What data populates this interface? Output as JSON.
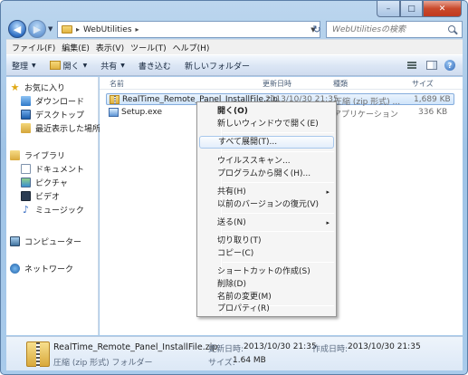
{
  "window": {
    "controls": {
      "minimize": "–",
      "maximize": "□",
      "close": "✕"
    }
  },
  "address": {
    "path": "WebUtilities",
    "separator": "▸"
  },
  "search": {
    "placeholder": "WebUtilitiesの検索"
  },
  "menubar": [
    "ファイル(F)",
    "編集(E)",
    "表示(V)",
    "ツール(T)",
    "ヘルプ(H)"
  ],
  "commandbar": {
    "organize": "整理",
    "open": "開く",
    "share": "共有",
    "burn": "書き込む",
    "new_folder": "新しいフォルダー"
  },
  "navpane": {
    "favorites": "お気に入り",
    "downloads": "ダウンロード",
    "desktop": "デスクトップ",
    "recent": "最近表示した場所",
    "libraries": "ライブラリ",
    "documents": "ドキュメント",
    "pictures": "ピクチャ",
    "videos": "ビデオ",
    "music": "ミュージック",
    "computer": "コンピューター",
    "network": "ネットワーク"
  },
  "columns": {
    "name": "名前",
    "modified": "更新日時",
    "type": "種類",
    "size": "サイズ"
  },
  "files": [
    {
      "name": "RealTime_Remote_Panel_InstallFile.zip",
      "modified": "2013/10/30 21:35",
      "type": "圧縮 (zip 形式) ...",
      "size": "1,689 KB"
    },
    {
      "name": "Setup.exe",
      "modified": "",
      "type": "アプリケーション",
      "size": "336 KB"
    }
  ],
  "context_menu": {
    "open": "開く(O)",
    "open_new_window": "新しいウィンドウで開く(E)",
    "extract_all": "すべて展開(T)...",
    "virus_scan": "ウイルススキャン...",
    "open_with": "プログラムから開く(H)...",
    "share": "共有(H)",
    "restore_previous": "以前のバージョンの復元(V)",
    "send_to": "送る(N)",
    "cut": "切り取り(T)",
    "copy": "コピー(C)",
    "create_shortcut": "ショートカットの作成(S)",
    "delete": "削除(D)",
    "rename": "名前の変更(M)",
    "properties": "プロパティ(R)",
    "submenu_arrow": "▸"
  },
  "details": {
    "filename": "RealTime_Remote_Panel_InstallFile.zip",
    "modified_label": "更新日時:",
    "modified_value": "2013/10/30 21:35",
    "created_label": "作成日時:",
    "created_value": "2013/10/30 21:35",
    "type": "圧縮 (zip 形式) フォルダー",
    "size_label": "サイズ:",
    "size_value": "1.64 MB"
  }
}
